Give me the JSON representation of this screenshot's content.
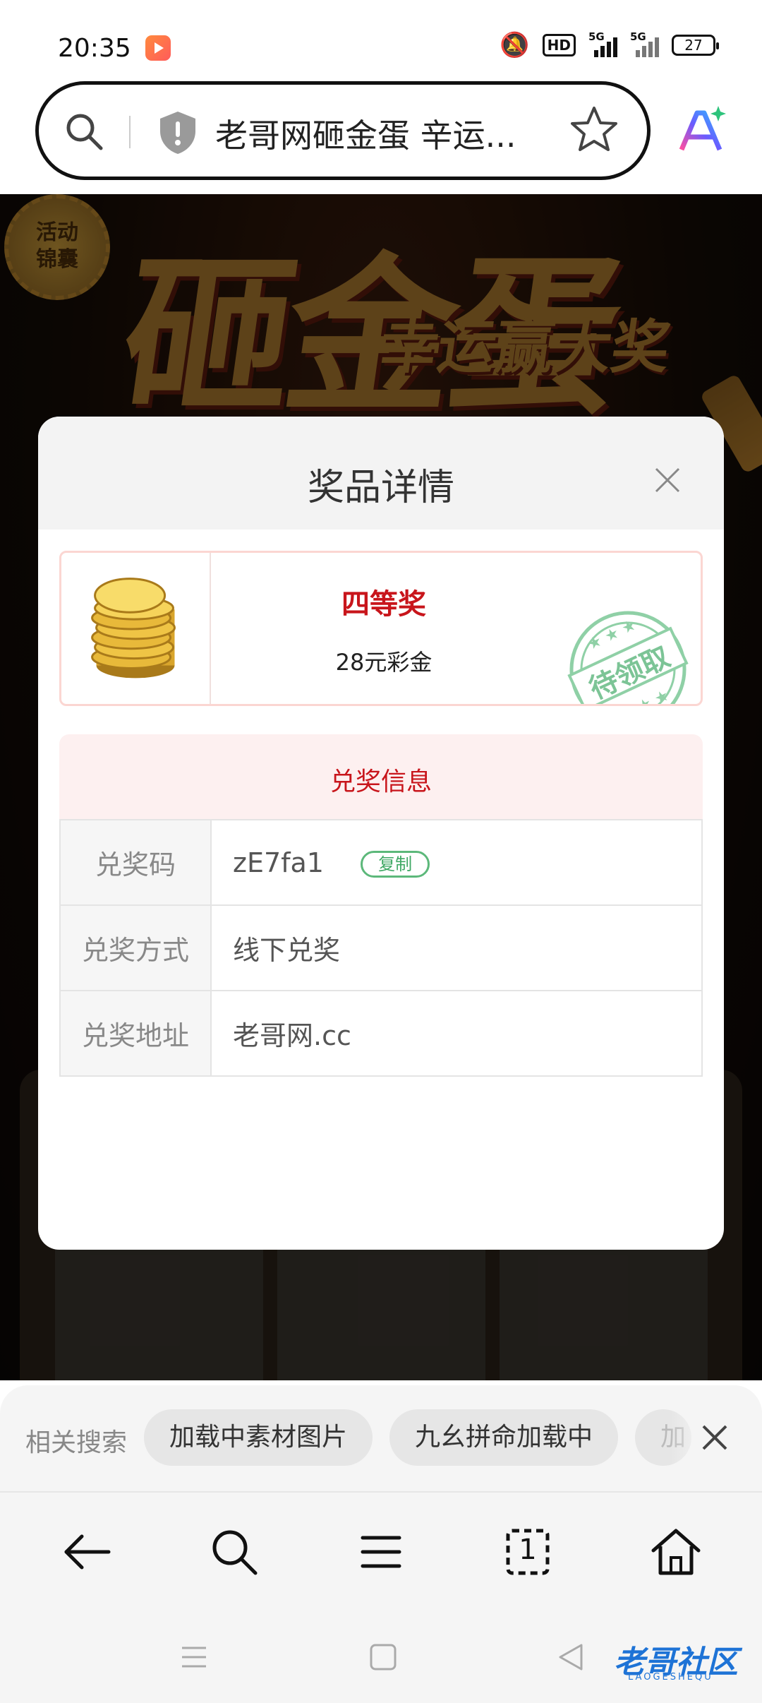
{
  "status_bar": {
    "time": "20:35",
    "network_hd": "HD",
    "sim1": "5G",
    "sim2": "5G",
    "battery": "27"
  },
  "address_bar": {
    "title": "老哥网砸金蛋 辛运...",
    "icons": [
      "search-icon",
      "shield-icon",
      "star-icon",
      "ai-icon"
    ]
  },
  "background_page": {
    "banner_title": "砸金蛋",
    "banner_subtitle": "幸运赢大奖",
    "badge": [
      "活动",
      "锦囊"
    ]
  },
  "modal": {
    "title": "奖品详情",
    "prize": {
      "level": "四等奖",
      "description": "28元彩金",
      "stamp": "待领取"
    },
    "redeem_section_title": "兑奖信息",
    "rows": [
      {
        "key": "兑奖码",
        "value": "zE7fa1"
      },
      {
        "key": "兑奖方式",
        "value": "线下兑奖"
      },
      {
        "key": "兑奖地址",
        "value": "老哥网.cc"
      }
    ],
    "copy_label": "复制"
  },
  "related_search": {
    "label": "相关搜索",
    "chips": [
      "加载中素材图片",
      "九幺拼命加载中",
      "加"
    ]
  },
  "bottom_nav": {
    "tab_count": "1"
  },
  "watermark": {
    "text": "老哥社区",
    "sub": "LAOGESHEQU"
  },
  "colors": {
    "accent_red": "#c8151b",
    "copy_green": "#3fa864",
    "stamp_green": "#7cc496"
  }
}
